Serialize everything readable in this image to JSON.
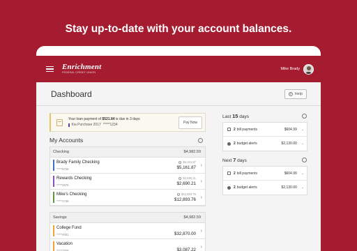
{
  "headline": "Stay up-to-date with your account balances.",
  "appbar": {
    "logo_main": "Enrichment",
    "logo_sub": "FEDERAL CREDIT UNION",
    "user_name": "Mike Brady"
  },
  "page": {
    "title": "Dashboard",
    "help_label": "Help"
  },
  "alert": {
    "prefix": "Your loan payment of",
    "amount": "$521.84",
    "suffix": "is due in 3 days",
    "account": "Kia Purchase 2017",
    "masked": "*****1234",
    "pay_label": "Pay Now"
  },
  "my_accounts": {
    "title": "My Accounts",
    "groups": [
      {
        "name": "Checking",
        "total": "$4,982.59",
        "accounts": [
          {
            "name": "Brady Family Checking",
            "masked": "*****5728",
            "available": "$5,161.87",
            "balance": "$5,161.87",
            "color": "#3b6fc4"
          },
          {
            "name": "Rewards Checking",
            "masked": "*****2678",
            "available": "$2,690.21",
            "balance": "$2,690.21",
            "color": "#8a4fbf"
          },
          {
            "name": "Mike's Checking",
            "masked": "*****1746",
            "available": "$12,893.76",
            "balance": "$12,893.76",
            "color": "#5a9b3b"
          }
        ]
      },
      {
        "name": "Savings",
        "total": "$4,982.59",
        "accounts": [
          {
            "name": "College Fund",
            "masked": "*****4001",
            "available": "",
            "balance": "$32,870.00",
            "color": "#f0a431"
          },
          {
            "name": "Vacation",
            "masked": "*****1928",
            "available": "",
            "balance": "$3,087.22",
            "color": "#f0a431"
          }
        ]
      }
    ]
  },
  "last_days": {
    "prefix": "Last",
    "count": "15",
    "suffix": "days",
    "rows": [
      {
        "count": "2",
        "label": "bill payments",
        "amount": "$604.99"
      },
      {
        "count": "2",
        "label": "budget alerts",
        "amount": "$2,130.00"
      }
    ]
  },
  "next_days": {
    "prefix": "Next",
    "count": "7",
    "suffix": "days",
    "rows": [
      {
        "count": "2",
        "label": "bill payments",
        "amount": "$604.99"
      },
      {
        "count": "2",
        "label": "budget alerts",
        "amount": "$2,130.00"
      }
    ]
  },
  "colors": {
    "brand": "#a51c30",
    "alert_accent": "#e1c36a"
  }
}
